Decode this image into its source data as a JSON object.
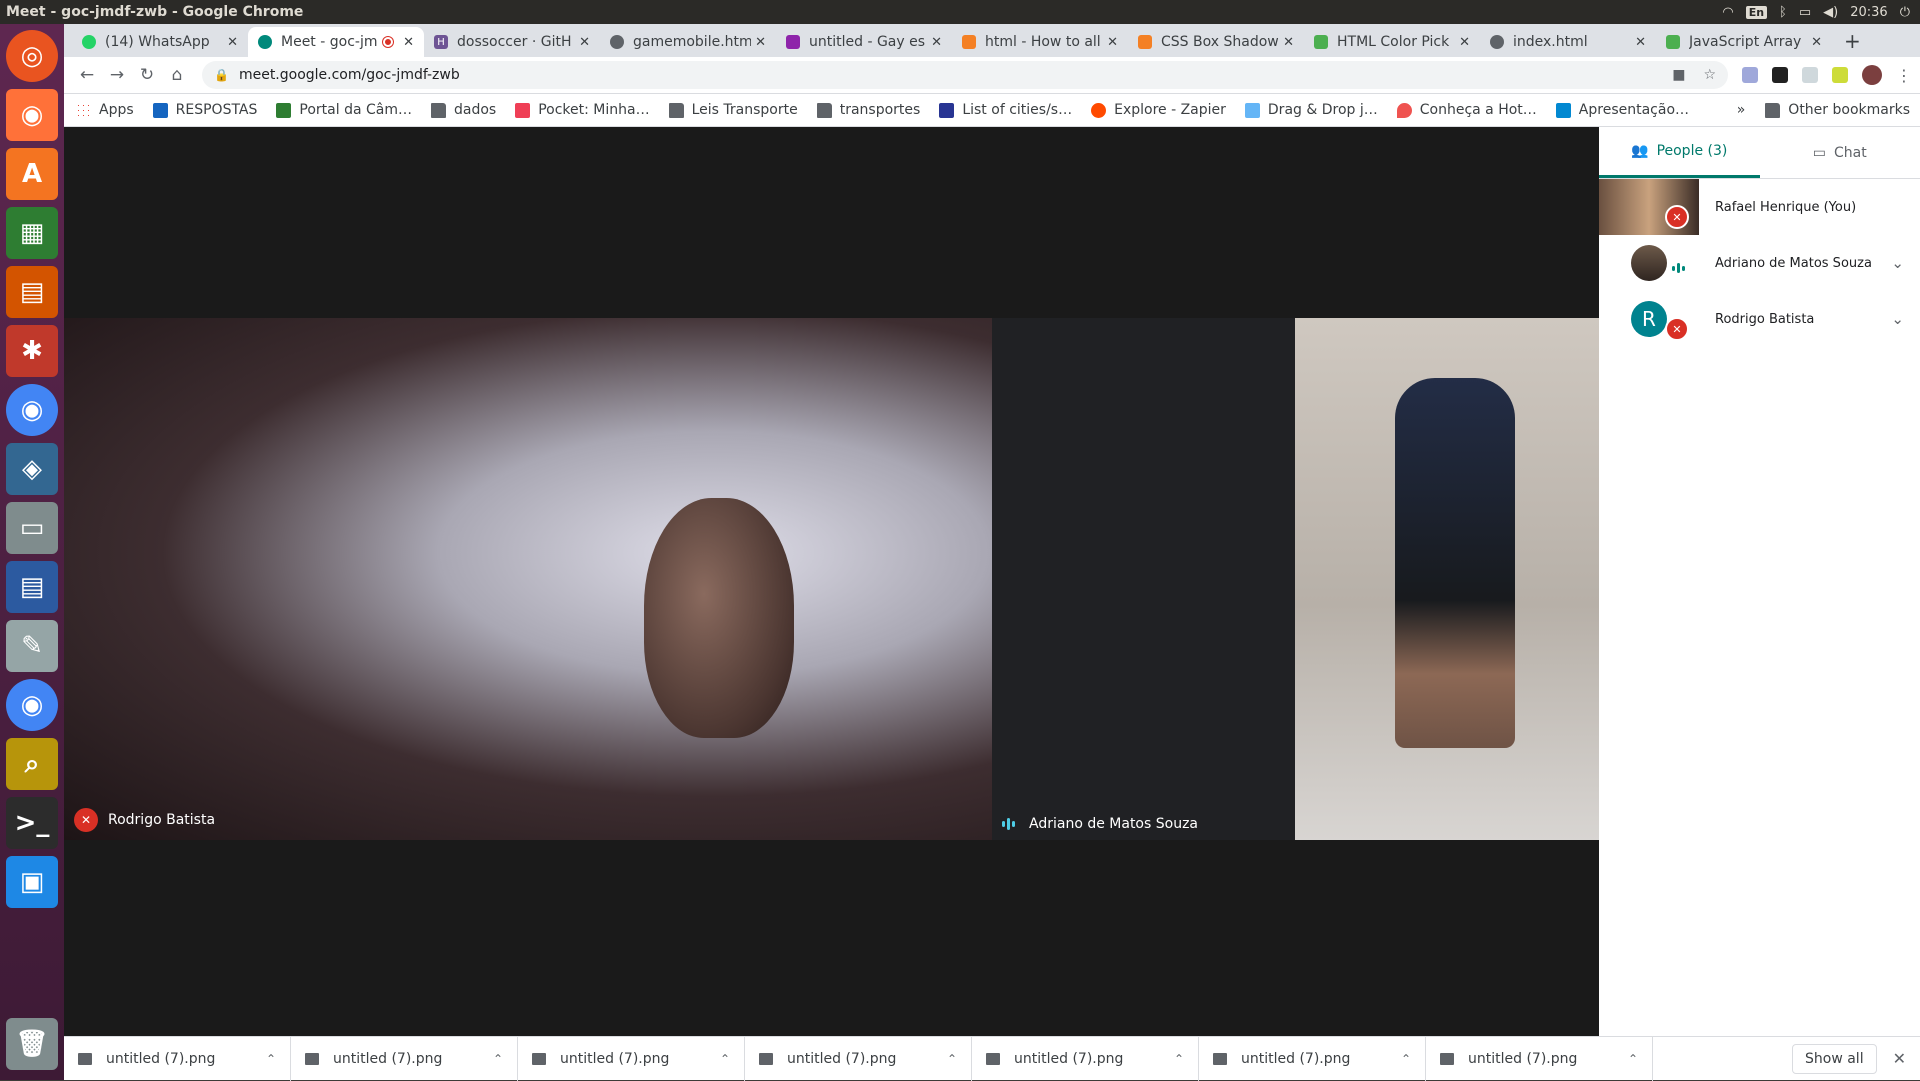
{
  "window": {
    "title": "Meet - goc-jmdf-zwb - Google Chrome"
  },
  "system": {
    "lang": "En",
    "time": "20:36"
  },
  "tabs": [
    {
      "label": "(14) WhatsApp",
      "color": "#25d366"
    },
    {
      "label": "Meet - goc-jm",
      "color": "#00897b"
    },
    {
      "label": "dossoccer · GitH",
      "color": "#6e5494"
    },
    {
      "label": "gamemobile.htm",
      "color": "#5f6368"
    },
    {
      "label": "untitled - Gay es",
      "color": "#8e24aa"
    },
    {
      "label": "html - How to all",
      "color": "#f48024"
    },
    {
      "label": "CSS Box Shadow",
      "color": "#f48024"
    },
    {
      "label": "HTML Color Pick",
      "color": "#4caf50"
    },
    {
      "label": "index.html",
      "color": "#5f6368"
    },
    {
      "label": "JavaScript Array",
      "color": "#4caf50"
    }
  ],
  "omnibox": {
    "url": "meet.google.com/goc-jmdf-zwb"
  },
  "bookmarks": [
    {
      "label": "Apps",
      "type": "apps"
    },
    {
      "label": "RESPOSTAS",
      "type": "site",
      "color": "#1565c0"
    },
    {
      "label": "Portal da Câm…",
      "type": "site",
      "color": "#2e7d32"
    },
    {
      "label": "dados",
      "type": "folder"
    },
    {
      "label": "Pocket: Minha…",
      "type": "site",
      "color": "#ef3f56"
    },
    {
      "label": "Leis Transporte",
      "type": "folder"
    },
    {
      "label": "transportes",
      "type": "folder"
    },
    {
      "label": "List of cities/s…",
      "type": "site",
      "color": "#283593"
    },
    {
      "label": "Explore - Zapier",
      "type": "site",
      "color": "#ff4a00"
    },
    {
      "label": "Drag & Drop j…",
      "type": "site",
      "color": "#64b5f6"
    },
    {
      "label": "Conheça a Hot…",
      "type": "site",
      "color": "#ef5350"
    },
    {
      "label": "Apresentação…",
      "type": "site",
      "color": "#0288d1"
    }
  ],
  "bookmarks_more": "»",
  "other_bookmarks": "Other bookmarks",
  "meet": {
    "tiles": [
      {
        "name": "Rodrigo Batista",
        "muted": true
      },
      {
        "name": "Adriano de Matos Souza",
        "speaking": true
      }
    ],
    "panel": {
      "people_tab": "People (3)",
      "chat_tab": "Chat",
      "participants": [
        {
          "name": "Rafael Henrique (You)"
        },
        {
          "name": "Adriano de Matos Souza"
        },
        {
          "name": "Rodrigo Batista",
          "initial": "R",
          "avatar_color": "#00838f"
        }
      ]
    }
  },
  "downloads": {
    "items": [
      "untitled (7).png",
      "untitled (7).png",
      "untitled (7).png",
      "untitled (7).png",
      "untitled (7).png",
      "untitled (7).png",
      "untitled (7).png"
    ],
    "show_all": "Show all"
  }
}
